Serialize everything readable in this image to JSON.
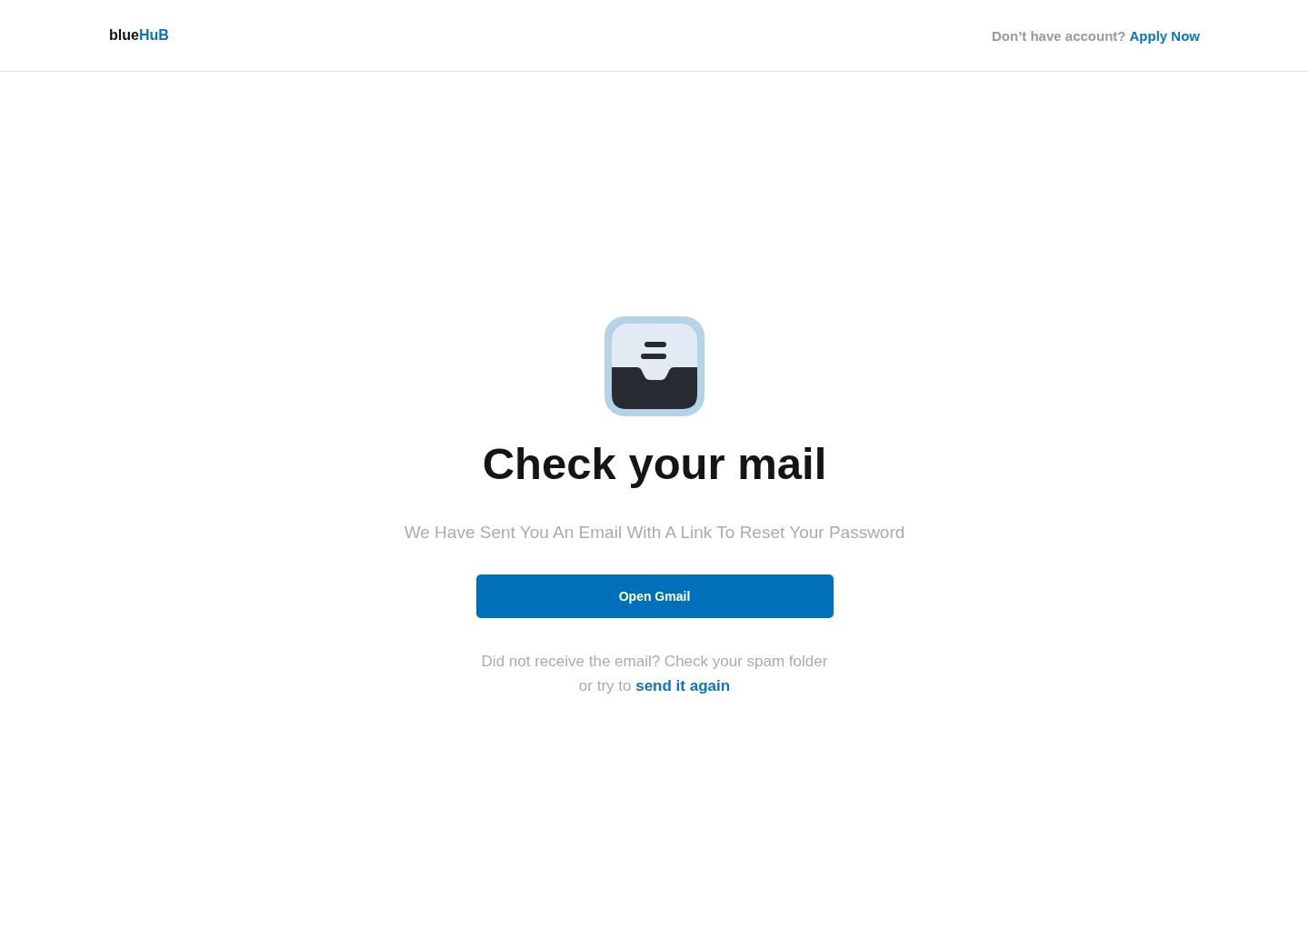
{
  "header": {
    "logo": {
      "dark_part": "blue",
      "accent_part": "HuB"
    },
    "prompt": "Don’t have account?",
    "link": "Apply Now"
  },
  "main": {
    "title": "Check your mail",
    "subtitle": "We Have Sent You An Email With A Link To Reset Your Password",
    "button": "Open Gmail",
    "note_line1": "Did not receive the email? Check your spam folder",
    "note_line2": "or try to",
    "note_link": "send it again"
  }
}
